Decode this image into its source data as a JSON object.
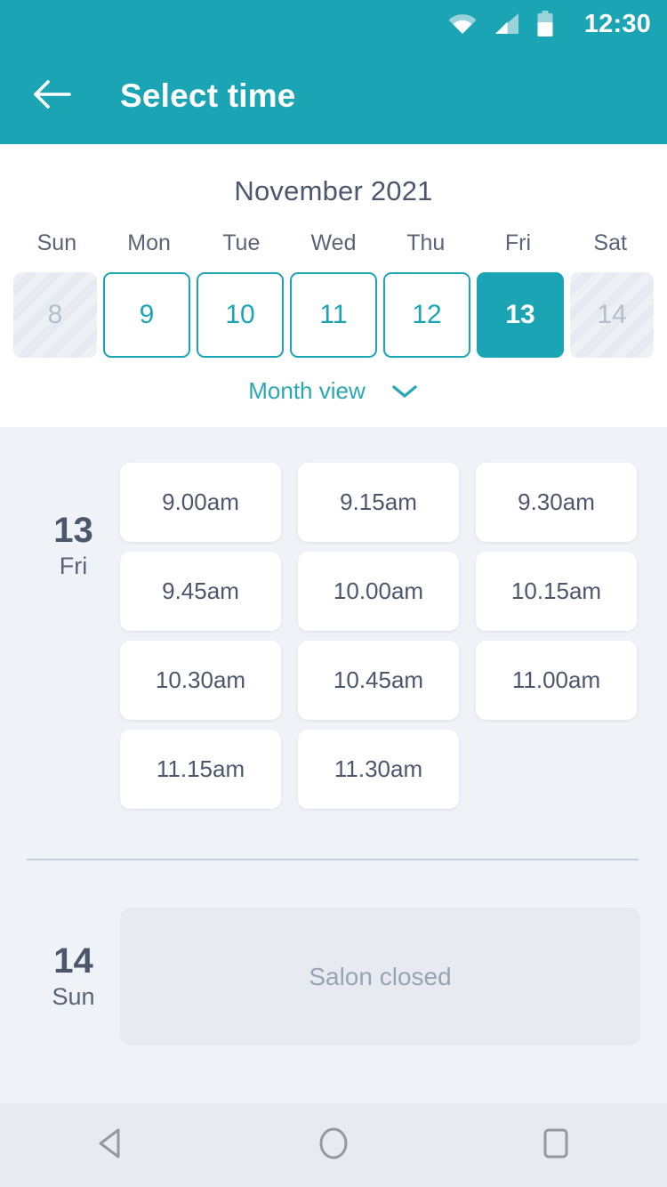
{
  "status_bar": {
    "time": "12:30",
    "icons": [
      "wifi-icon",
      "signal-icon",
      "battery-icon"
    ]
  },
  "app_bar": {
    "back_icon": "arrow-left-icon",
    "title": "Select time"
  },
  "calendar": {
    "month_label": "November 2021",
    "weekdays": [
      "Sun",
      "Mon",
      "Tue",
      "Wed",
      "Thu",
      "Fri",
      "Sat"
    ],
    "days": [
      {
        "num": "8",
        "state": "disabled"
      },
      {
        "num": "9",
        "state": "available"
      },
      {
        "num": "10",
        "state": "available"
      },
      {
        "num": "11",
        "state": "available"
      },
      {
        "num": "12",
        "state": "available"
      },
      {
        "num": "13",
        "state": "selected"
      },
      {
        "num": "14",
        "state": "disabled"
      }
    ],
    "month_view_label": "Month view",
    "month_view_icon": "chevron-down-icon"
  },
  "schedule": [
    {
      "date_num": "13",
      "day_of_week": "Fri",
      "slots": [
        "9.00am",
        "9.15am",
        "9.30am",
        "9.45am",
        "10.00am",
        "10.15am",
        "10.30am",
        "10.45am",
        "11.00am",
        "11.15am",
        "11.30am"
      ]
    },
    {
      "date_num": "14",
      "day_of_week": "Sun",
      "closed_message": "Salon closed"
    }
  ],
  "nav_bar": {
    "back_icon": "triangle-back-icon",
    "home_icon": "circle-home-icon",
    "recents_icon": "square-recents-icon"
  },
  "colors": {
    "accent_teal": "#1BA5B4",
    "page_background": "#EFF2F7",
    "panel_white": "#FFFFFF",
    "text_dark": "#4C576C",
    "text_muted": "#9AA3B2",
    "nav_background": "#E7EAEE"
  }
}
